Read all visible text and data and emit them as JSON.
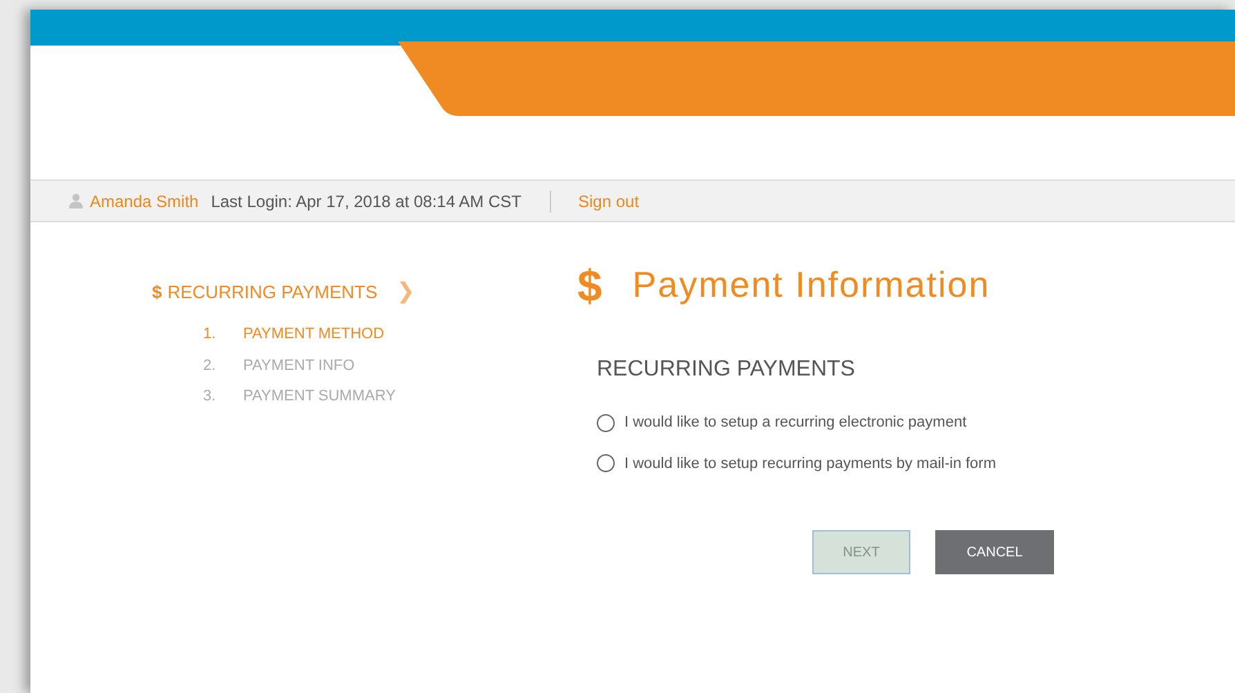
{
  "user_bar": {
    "user_name": "Amanda Smith",
    "last_login": "Last Login: Apr 17, 2018 at 08:14 AM CST",
    "sign_out": "Sign out"
  },
  "sidebar": {
    "icon": "$",
    "title": "RECURRING PAYMENTS",
    "arrow": "❯",
    "steps": [
      {
        "number": "1.",
        "label": "PAYMENT METHOD",
        "selected": true
      },
      {
        "number": "2.",
        "label": "PAYMENT INFO",
        "selected": false
      },
      {
        "number": "3.",
        "label": "PAYMENT SUMMARY",
        "selected": false
      }
    ]
  },
  "main": {
    "icon": "$",
    "title": "Payment Information",
    "section_title": "RECURRING PAYMENTS",
    "options": [
      {
        "label": "I would like to setup a recurring electronic payment",
        "selected": false
      },
      {
        "label": "I would like to setup recurring payments by mail-in form",
        "selected": false
      }
    ],
    "buttons": [
      {
        "label": "NEXT",
        "kind": "primary",
        "disabled": true
      },
      {
        "label": "CANCEL",
        "kind": "secondary",
        "disabled": false
      }
    ]
  }
}
